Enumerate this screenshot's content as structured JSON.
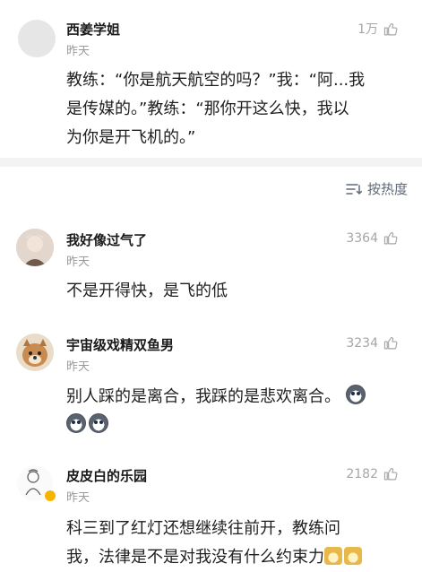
{
  "post": {
    "author": "西姜学姐",
    "time": "昨天",
    "likes": "1万",
    "lines": [
      "教练：“你是航天航空的吗？”我：“阿...我",
      "是传媒的。”教练：“那你开这么快，我以",
      "为你是开飞机的。”"
    ]
  },
  "sort_label": "按热度",
  "comments": [
    {
      "author": "我好像过气了",
      "time": "昨天",
      "likes": "3364",
      "lines": [
        "不是开得快，是飞的低"
      ]
    },
    {
      "author": "宇宙级戏精双鱼男",
      "time": "昨天",
      "likes": "3234",
      "lines": [
        "别人踩的是离合，我踩的是悲欢离合。"
      ]
    },
    {
      "author": "皮皮白的乐园",
      "time": "昨天",
      "likes": "2182",
      "lines": [
        "科三到了红灯还想继续往前开，教练问",
        "我，法律是不是对我没有什么约束力"
      ]
    }
  ],
  "colors": {
    "divider": "#f3f3f3",
    "meta": "#9a9a9a",
    "sort": "#5f6a7a"
  }
}
